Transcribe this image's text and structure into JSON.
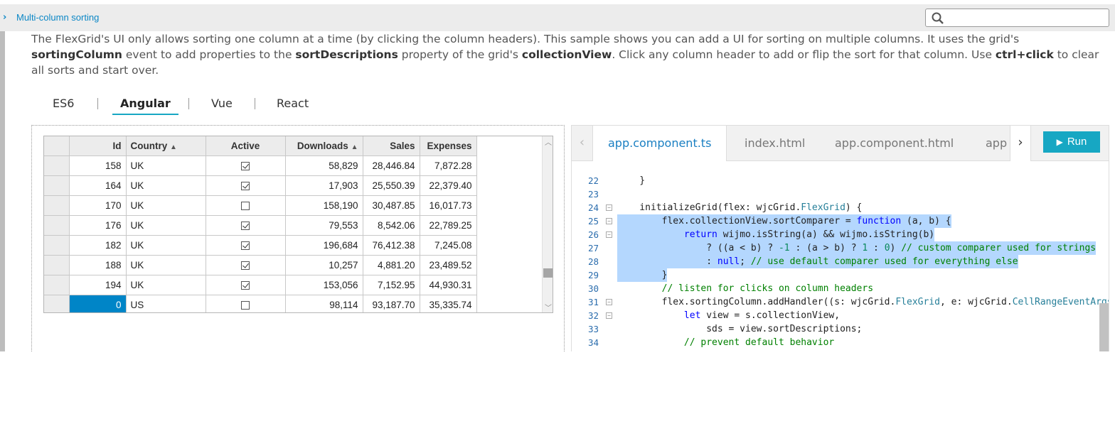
{
  "header": {
    "chevron": "›",
    "title": "Multi-column sorting"
  },
  "search": {
    "placeholder": ""
  },
  "description": {
    "p1": "The FlexGrid's UI only allows sorting one column at a time (by clicking the column headers). This sample shows you can add a UI for sorting on multiple columns. It uses the grid's ",
    "k1": "sortingColumn",
    "p2": " event to add properties to the ",
    "k2": "sortDescriptions",
    "p3": " property of the grid's ",
    "k3": "collectionView",
    "p4": ". Click any column header to add or flip the sort for that column. Use ",
    "k4": "ctrl+click",
    "p5": " to clear all sorts and start over."
  },
  "lang_tabs": [
    "ES6",
    "Angular",
    "Vue",
    "React"
  ],
  "grid": {
    "columns": [
      "Id",
      "Country",
      "Active",
      "Downloads",
      "Sales",
      "Expenses"
    ],
    "sort_indicator": "▲",
    "rows": [
      {
        "id": "158",
        "country": "UK",
        "active": true,
        "downloads": "58,829",
        "sales": "28,446.84",
        "expenses": "7,872.28"
      },
      {
        "id": "164",
        "country": "UK",
        "active": true,
        "downloads": "17,903",
        "sales": "25,550.39",
        "expenses": "22,379.40"
      },
      {
        "id": "170",
        "country": "UK",
        "active": false,
        "downloads": "158,190",
        "sales": "30,487.85",
        "expenses": "16,017.73"
      },
      {
        "id": "176",
        "country": "UK",
        "active": true,
        "downloads": "79,553",
        "sales": "8,542.06",
        "expenses": "22,789.25"
      },
      {
        "id": "182",
        "country": "UK",
        "active": true,
        "downloads": "196,684",
        "sales": "76,412.38",
        "expenses": "7,245.08"
      },
      {
        "id": "188",
        "country": "UK",
        "active": true,
        "downloads": "10,257",
        "sales": "4,881.20",
        "expenses": "23,489.52"
      },
      {
        "id": "194",
        "country": "UK",
        "active": true,
        "downloads": "153,056",
        "sales": "7,152.95",
        "expenses": "44,930.31"
      },
      {
        "id": "0",
        "country": "US",
        "active": false,
        "downloads": "98,114",
        "sales": "93,187.70",
        "expenses": "35,335.74"
      }
    ]
  },
  "code_tabs": [
    "app.component.ts",
    "index.html",
    "app.component.html",
    "app"
  ],
  "run_label": "Run",
  "colors": {
    "accent": "#17a7c3",
    "link": "#0b87c6",
    "selection": "#0085c7",
    "highlight": "#b4d7fe"
  },
  "code_lines": [
    {
      "n": "22",
      "text": "    }"
    },
    {
      "n": "23",
      "text": ""
    },
    {
      "n": "24",
      "text": "    initializeGrid(flex: wjcGrid.FlexGrid) {"
    },
    {
      "n": "25",
      "text": "        flex.collectionView.sortComparer = function (a, b) {"
    },
    {
      "n": "26",
      "text": "            return wijmo.isString(a) && wijmo.isString(b)"
    },
    {
      "n": "27",
      "text": "                ? ((a < b) ? -1 : (a > b) ? 1 : 0) // custom comparer used for strings"
    },
    {
      "n": "28",
      "text": "                : null; // use default comparer used for everything else"
    },
    {
      "n": "29",
      "text": "        }"
    },
    {
      "n": "30",
      "text": "        // listen for clicks on column headers"
    },
    {
      "n": "31",
      "text": "        flex.sortingColumn.addHandler((s: wjcGrid.FlexGrid, e: wjcGrid.CellRangeEventArgs) => {"
    },
    {
      "n": "32",
      "text": "            let view = s.collectionView,"
    },
    {
      "n": "33",
      "text": "                sds = view.sortDescriptions;"
    },
    {
      "n": "34",
      "text": "            // prevent default behavior"
    }
  ]
}
